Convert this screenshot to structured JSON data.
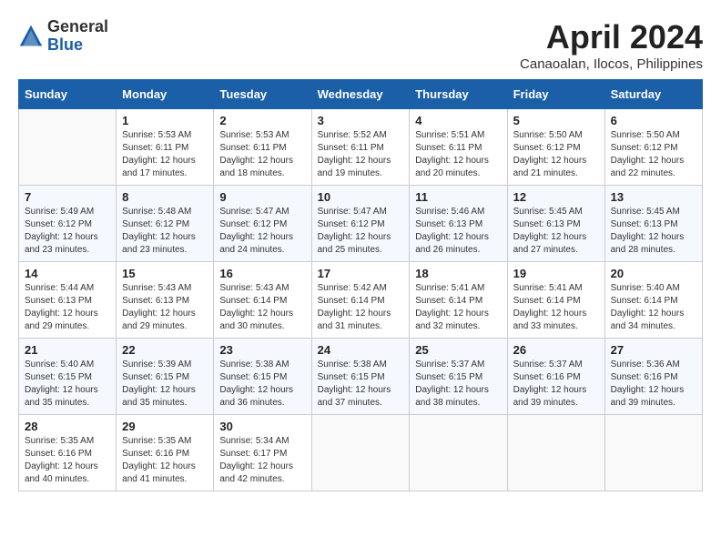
{
  "header": {
    "logo_general": "General",
    "logo_blue": "Blue",
    "month_year": "April 2024",
    "location": "Canaoalan, Ilocos, Philippines"
  },
  "calendar": {
    "days_of_week": [
      "Sunday",
      "Monday",
      "Tuesday",
      "Wednesday",
      "Thursday",
      "Friday",
      "Saturday"
    ],
    "weeks": [
      [
        {
          "day": "",
          "sunrise": "",
          "sunset": "",
          "daylight": ""
        },
        {
          "day": "1",
          "sunrise": "Sunrise: 5:53 AM",
          "sunset": "Sunset: 6:11 PM",
          "daylight": "Daylight: 12 hours and 17 minutes."
        },
        {
          "day": "2",
          "sunrise": "Sunrise: 5:53 AM",
          "sunset": "Sunset: 6:11 PM",
          "daylight": "Daylight: 12 hours and 18 minutes."
        },
        {
          "day": "3",
          "sunrise": "Sunrise: 5:52 AM",
          "sunset": "Sunset: 6:11 PM",
          "daylight": "Daylight: 12 hours and 19 minutes."
        },
        {
          "day": "4",
          "sunrise": "Sunrise: 5:51 AM",
          "sunset": "Sunset: 6:11 PM",
          "daylight": "Daylight: 12 hours and 20 minutes."
        },
        {
          "day": "5",
          "sunrise": "Sunrise: 5:50 AM",
          "sunset": "Sunset: 6:12 PM",
          "daylight": "Daylight: 12 hours and 21 minutes."
        },
        {
          "day": "6",
          "sunrise": "Sunrise: 5:50 AM",
          "sunset": "Sunset: 6:12 PM",
          "daylight": "Daylight: 12 hours and 22 minutes."
        }
      ],
      [
        {
          "day": "7",
          "sunrise": "Sunrise: 5:49 AM",
          "sunset": "Sunset: 6:12 PM",
          "daylight": "Daylight: 12 hours and 23 minutes."
        },
        {
          "day": "8",
          "sunrise": "Sunrise: 5:48 AM",
          "sunset": "Sunset: 6:12 PM",
          "daylight": "Daylight: 12 hours and 23 minutes."
        },
        {
          "day": "9",
          "sunrise": "Sunrise: 5:47 AM",
          "sunset": "Sunset: 6:12 PM",
          "daylight": "Daylight: 12 hours and 24 minutes."
        },
        {
          "day": "10",
          "sunrise": "Sunrise: 5:47 AM",
          "sunset": "Sunset: 6:12 PM",
          "daylight": "Daylight: 12 hours and 25 minutes."
        },
        {
          "day": "11",
          "sunrise": "Sunrise: 5:46 AM",
          "sunset": "Sunset: 6:13 PM",
          "daylight": "Daylight: 12 hours and 26 minutes."
        },
        {
          "day": "12",
          "sunrise": "Sunrise: 5:45 AM",
          "sunset": "Sunset: 6:13 PM",
          "daylight": "Daylight: 12 hours and 27 minutes."
        },
        {
          "day": "13",
          "sunrise": "Sunrise: 5:45 AM",
          "sunset": "Sunset: 6:13 PM",
          "daylight": "Daylight: 12 hours and 28 minutes."
        }
      ],
      [
        {
          "day": "14",
          "sunrise": "Sunrise: 5:44 AM",
          "sunset": "Sunset: 6:13 PM",
          "daylight": "Daylight: 12 hours and 29 minutes."
        },
        {
          "day": "15",
          "sunrise": "Sunrise: 5:43 AM",
          "sunset": "Sunset: 6:13 PM",
          "daylight": "Daylight: 12 hours and 29 minutes."
        },
        {
          "day": "16",
          "sunrise": "Sunrise: 5:43 AM",
          "sunset": "Sunset: 6:14 PM",
          "daylight": "Daylight: 12 hours and 30 minutes."
        },
        {
          "day": "17",
          "sunrise": "Sunrise: 5:42 AM",
          "sunset": "Sunset: 6:14 PM",
          "daylight": "Daylight: 12 hours and 31 minutes."
        },
        {
          "day": "18",
          "sunrise": "Sunrise: 5:41 AM",
          "sunset": "Sunset: 6:14 PM",
          "daylight": "Daylight: 12 hours and 32 minutes."
        },
        {
          "day": "19",
          "sunrise": "Sunrise: 5:41 AM",
          "sunset": "Sunset: 6:14 PM",
          "daylight": "Daylight: 12 hours and 33 minutes."
        },
        {
          "day": "20",
          "sunrise": "Sunrise: 5:40 AM",
          "sunset": "Sunset: 6:14 PM",
          "daylight": "Daylight: 12 hours and 34 minutes."
        }
      ],
      [
        {
          "day": "21",
          "sunrise": "Sunrise: 5:40 AM",
          "sunset": "Sunset: 6:15 PM",
          "daylight": "Daylight: 12 hours and 35 minutes."
        },
        {
          "day": "22",
          "sunrise": "Sunrise: 5:39 AM",
          "sunset": "Sunset: 6:15 PM",
          "daylight": "Daylight: 12 hours and 35 minutes."
        },
        {
          "day": "23",
          "sunrise": "Sunrise: 5:38 AM",
          "sunset": "Sunset: 6:15 PM",
          "daylight": "Daylight: 12 hours and 36 minutes."
        },
        {
          "day": "24",
          "sunrise": "Sunrise: 5:38 AM",
          "sunset": "Sunset: 6:15 PM",
          "daylight": "Daylight: 12 hours and 37 minutes."
        },
        {
          "day": "25",
          "sunrise": "Sunrise: 5:37 AM",
          "sunset": "Sunset: 6:15 PM",
          "daylight": "Daylight: 12 hours and 38 minutes."
        },
        {
          "day": "26",
          "sunrise": "Sunrise: 5:37 AM",
          "sunset": "Sunset: 6:16 PM",
          "daylight": "Daylight: 12 hours and 39 minutes."
        },
        {
          "day": "27",
          "sunrise": "Sunrise: 5:36 AM",
          "sunset": "Sunset: 6:16 PM",
          "daylight": "Daylight: 12 hours and 39 minutes."
        }
      ],
      [
        {
          "day": "28",
          "sunrise": "Sunrise: 5:35 AM",
          "sunset": "Sunset: 6:16 PM",
          "daylight": "Daylight: 12 hours and 40 minutes."
        },
        {
          "day": "29",
          "sunrise": "Sunrise: 5:35 AM",
          "sunset": "Sunset: 6:16 PM",
          "daylight": "Daylight: 12 hours and 41 minutes."
        },
        {
          "day": "30",
          "sunrise": "Sunrise: 5:34 AM",
          "sunset": "Sunset: 6:17 PM",
          "daylight": "Daylight: 12 hours and 42 minutes."
        },
        {
          "day": "",
          "sunrise": "",
          "sunset": "",
          "daylight": ""
        },
        {
          "day": "",
          "sunrise": "",
          "sunset": "",
          "daylight": ""
        },
        {
          "day": "",
          "sunrise": "",
          "sunset": "",
          "daylight": ""
        },
        {
          "day": "",
          "sunrise": "",
          "sunset": "",
          "daylight": ""
        }
      ]
    ]
  }
}
